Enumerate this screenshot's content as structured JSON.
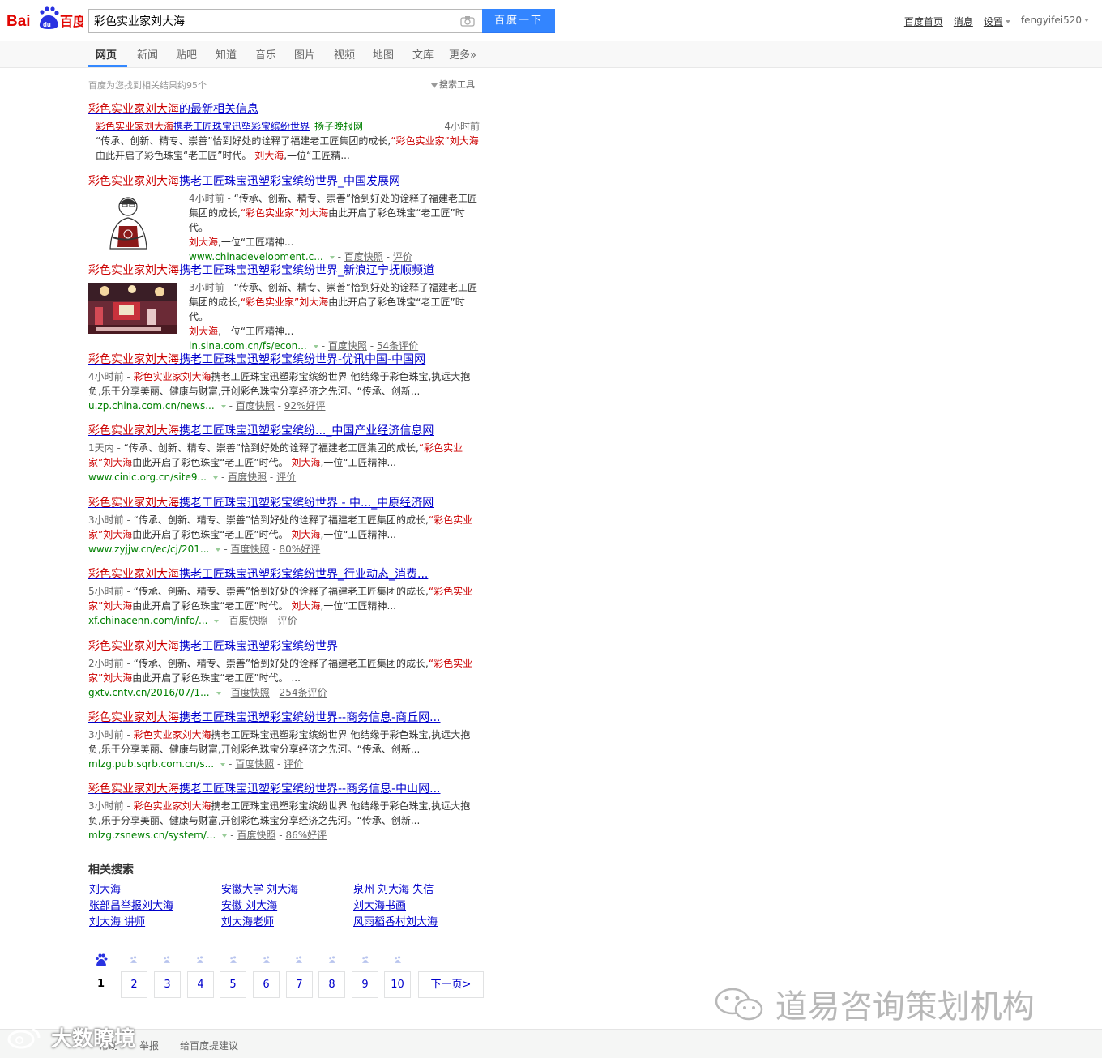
{
  "header": {
    "query": "彩色实业家刘大海",
    "search_button": "百度一下",
    "links": [
      "百度首页",
      "消息",
      "设置"
    ],
    "user": "fengyifei520"
  },
  "nav": {
    "tabs": [
      "网页",
      "新闻",
      "贴吧",
      "知道",
      "音乐",
      "图片",
      "视频",
      "地图",
      "文库",
      "更多»"
    ]
  },
  "result_count": "百度为您找到相关结果约95个",
  "search_tools": "搜索工具",
  "results": [
    {
      "title_em": "彩色实业家刘大海",
      "title_rest": "的最新相关信息",
      "news_em": "彩色实业家刘大海",
      "news_rest": "携老工匠珠宝迅塑彩宝缤纷世界",
      "news_source": "扬子晚报网",
      "news_time": "4小时前",
      "abs_a": "“传承、创新、精专、崇善”恰到好处的诠释了福建老工匠集团的成长,",
      "abs_em1": "“彩色实业家”刘大海",
      "abs_b": "由此开启了彩色珠宝“老工匠”时代。",
      "abs_em2": "刘大海",
      "abs_c": ",一位“工匠精..."
    },
    {
      "title_em": "彩色实业家刘大海",
      "title_rest": "携老工匠珠宝迅塑彩宝缤纷世界_中国发展网",
      "time": "4小时前 - ",
      "abs_a": "“传承、创新、精专、崇善”恰到好处的诠释了福建老工匠集团的成长,",
      "abs_em1": "“彩色实业家”刘大海",
      "abs_b": "由此开启了彩色珠宝“老工匠”时代。",
      "abs_em2": "刘大海",
      "abs_c": ",一位“工匠精神...",
      "url": "www.chinadevelopment.c...",
      "snap": "百度快照",
      "rating": "评价"
    },
    {
      "title_em": "彩色实业家刘大海",
      "title_rest": "携老工匠珠宝迅塑彩宝缤纷世界_新浪辽宁抚顺频道",
      "time": "3小时前 - ",
      "abs_a": "“传承、创新、精专、崇善”恰到好处的诠释了福建老工匠集团的成长,",
      "abs_em1": "“彩色实业家”刘大海",
      "abs_b": "由此开启了彩色珠宝“老工匠”时代。",
      "abs_em2": "刘大海",
      "abs_c": ",一位“工匠精神...",
      "url": "ln.sina.com.cn/fs/econ...",
      "snap": "百度快照",
      "rating": "54条评价"
    },
    {
      "title_em": "彩色实业家刘大海",
      "title_rest": "携老工匠珠宝迅塑彩宝缤纷世界-优讯中国-中国网",
      "time": "4小时前 - ",
      "abs_em1": "彩色实业家刘大海",
      "abs_a": "携老工匠珠宝迅塑彩宝缤纷世界 他结缘于彩色珠宝,执远大抱负,乐于分享美丽、健康与财富,开创彩色珠宝分享经济之先河。“传承、创新...",
      "url": "u.zp.china.com.cn/news...",
      "snap": "百度快照",
      "rating": "92%好评"
    },
    {
      "title_em": "彩色实业家刘大海",
      "title_rest": "携老工匠珠宝迅塑彩宝缤纷..._中国产业经济信息网",
      "time": "1天内 - ",
      "abs_a": "“传承、创新、精专、崇善”恰到好处的诠释了福建老工匠集团的成长,",
      "abs_em1": "“彩色实业家”刘大海",
      "abs_b": "由此开启了彩色珠宝“老工匠”时代。",
      "abs_em2": "刘大海",
      "abs_c": ",一位“工匠精神...",
      "url": "www.cinic.org.cn/site9...",
      "snap": "百度快照",
      "rating": "评价"
    },
    {
      "title_em": "彩色实业家刘大海",
      "title_rest": "携老工匠珠宝迅塑彩宝缤纷世界 - 中..._中原经济网",
      "time": "3小时前 - ",
      "abs_a": "“传承、创新、精专、崇善”恰到好处的诠释了福建老工匠集团的成长,",
      "abs_em1": "“彩色实业家”刘大海",
      "abs_b": "由此开启了彩色珠宝“老工匠”时代。",
      "abs_em2": "刘大海",
      "abs_c": ",一位“工匠精神...",
      "url": "www.zyjjw.cn/ec/cj/201...",
      "snap": "百度快照",
      "rating": "80%好评"
    },
    {
      "title_em": "彩色实业家刘大海",
      "title_rest": "携老工匠珠宝迅塑彩宝缤纷世界_行业动态_消费...",
      "time": "5小时前 - ",
      "abs_a": "“传承、创新、精专、崇善”恰到好处的诠释了福建老工匠集团的成长,",
      "abs_em1": "“彩色实业家”刘大海",
      "abs_b": "由此开启了彩色珠宝“老工匠”时代。",
      "abs_em2": "刘大海",
      "abs_c": ",一位“工匠精神...",
      "url": "xf.chinacenn.com/info/...",
      "snap": "百度快照",
      "rating": "评价"
    },
    {
      "title_em": "彩色实业家刘大海",
      "title_rest": "携老工匠珠宝迅塑彩宝缤纷世界",
      "time": "2小时前 - ",
      "abs_a": "“传承、创新、精专、崇善”恰到好处的诠释了福建老工匠集团的成长,",
      "abs_em1": "“彩色实业家”刘大海",
      "abs_b": "由此开启了彩色珠宝“老工匠”时代。 ...",
      "abs_em2": "",
      "abs_c": "",
      "url": "gxtv.cntv.cn/2016/07/1...",
      "snap": "百度快照",
      "rating": "254条评价"
    },
    {
      "title_em": "彩色实业家刘大海",
      "title_rest": "携老工匠珠宝迅塑彩宝缤纷世界--商务信息-商丘网...",
      "time": "3小时前 - ",
      "abs_em1": "彩色实业家刘大海",
      "abs_a": "携老工匠珠宝迅塑彩宝缤纷世界 他结缘于彩色珠宝,执远大抱负,乐于分享美丽、健康与财富,开创彩色珠宝分享经济之先河。“传承、创新...",
      "url": "mlzg.pub.sqrb.com.cn/s...",
      "snap": "百度快照",
      "rating": "评价"
    },
    {
      "title_em": "彩色实业家刘大海",
      "title_rest": "携老工匠珠宝迅塑彩宝缤纷世界--商务信息-中山网...",
      "time": "3小时前 - ",
      "abs_em1": "彩色实业家刘大海",
      "abs_a": "携老工匠珠宝迅塑彩宝缤纷世界 他结缘于彩色珠宝,执远大抱负,乐于分享美丽、健康与财富,开创彩色珠宝分享经济之先河。“传承、创新...",
      "url": "mlzg.zsnews.cn/system/...",
      "snap": "百度快照",
      "rating": "86%好评"
    }
  ],
  "related": {
    "title": "相关搜索",
    "items": [
      "刘大海",
      "安徽大学 刘大海",
      "泉州 刘大海 失信",
      "张部昌举报刘大海",
      "安徽 刘大海",
      "刘大海书画",
      "刘大海 讲师",
      "刘大海老师",
      "风雨稻香村刘大海"
    ]
  },
  "pager": {
    "pages": [
      "1",
      "2",
      "3",
      "4",
      "5",
      "6",
      "7",
      "8",
      "9",
      "10"
    ],
    "next": "下一页>"
  },
  "footer": [
    "帮助",
    "举报",
    "给百度提建议"
  ],
  "watermark": "道易咨询策划机构",
  "watermark_left": "大数瞭境",
  "colors": {
    "brand_blue": "#3385ff",
    "link": "#0000cc",
    "em": "#cc0000",
    "url": "#008000"
  }
}
